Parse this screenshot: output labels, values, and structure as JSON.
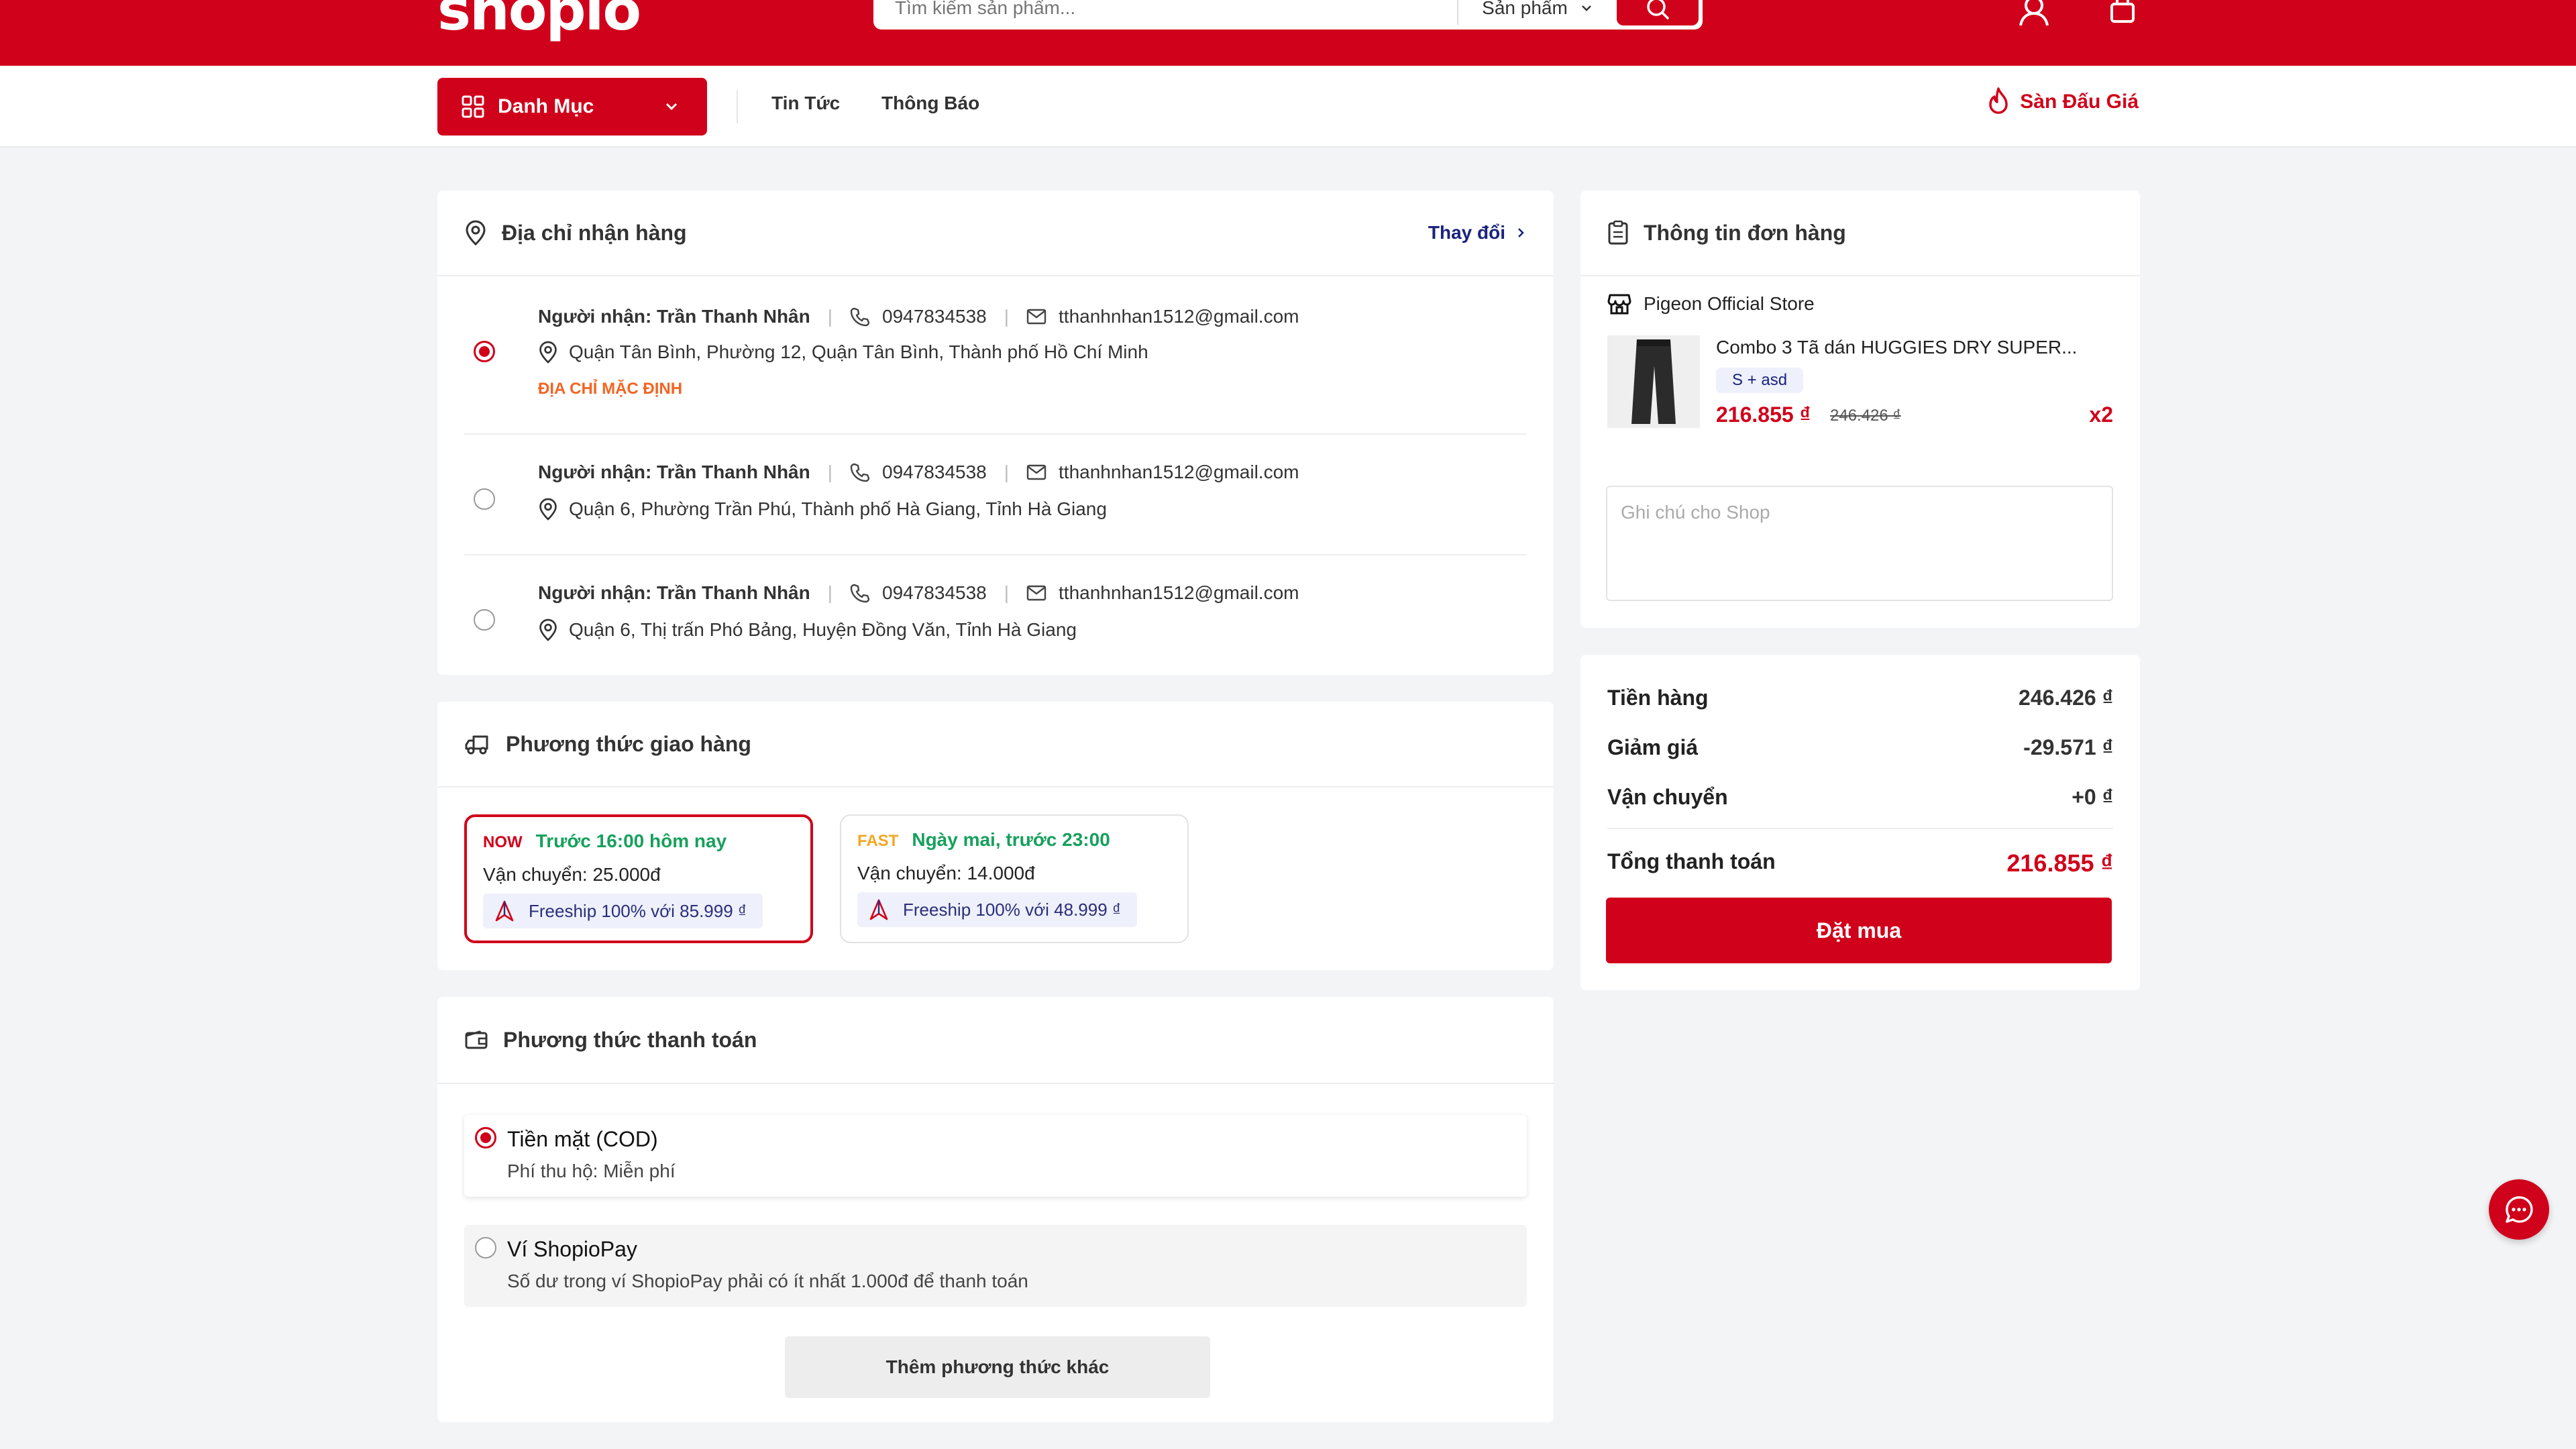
{
  "header": {
    "logo": "shopio",
    "search_placeholder": "Tìm kiếm sản phẩm...",
    "search_category": "Sản phẩm"
  },
  "nav": {
    "category_label": "Danh Mục",
    "links": [
      "Tin Tức",
      "Thông Báo"
    ],
    "auction_label": "Sàn Đấu Giá"
  },
  "address": {
    "title": "Địa chỉ nhận hàng",
    "change_label": "Thay đổi",
    "items": [
      {
        "recipient": "Người nhận: Trần Thanh Nhân",
        "phone": "0947834538",
        "email": "tthanhnhan1512@gmail.com",
        "address": "Quận Tân Bình, Phường 12, Quận Tân Bình, Thành phố Hồ Chí Minh",
        "badge": "ĐỊA CHỈ MẶC ĐỊNH",
        "selected": true
      },
      {
        "recipient": "Người nhận: Trần Thanh Nhân",
        "phone": "0947834538",
        "email": "tthanhnhan1512@gmail.com",
        "address": "Quận 6, Phường Trần Phú, Thành phố Hà Giang, Tỉnh Hà Giang",
        "selected": false
      },
      {
        "recipient": "Người nhận: Trần Thanh Nhân",
        "phone": "0947834538",
        "email": "tthanhnhan1512@gmail.com",
        "address": "Quận 6, Thị trấn Phó Bảng, Huyện Đồng Văn, Tỉnh Hà Giang",
        "selected": false
      }
    ]
  },
  "shipping": {
    "title": "Phương thức giao hàng",
    "options": [
      {
        "tag": "NOW",
        "tag_color": "#d0021b",
        "time": "Trước 16:00 hôm nay",
        "fee": "Vận chuyển: 25.000đ",
        "freeship": "Freeship 100% với 85.999 ₫",
        "selected": true
      },
      {
        "tag": "FAST",
        "tag_color": "#f5a623",
        "time": "Ngày mai, trước 23:00",
        "fee": "Vận chuyển: 14.000đ",
        "freeship": "Freeship 100% với 48.999 ₫",
        "selected": false
      }
    ]
  },
  "payment": {
    "title": "Phương thức thanh toán",
    "options": [
      {
        "title": "Tiền mặt (COD)",
        "desc": "Phí thu hộ: Miễn phí",
        "selected": true
      },
      {
        "title": "Ví ShopioPay",
        "desc": "Số dư trong ví ShopioPay phải có ít nhất 1.000đ để thanh toán",
        "selected": false
      }
    ],
    "more_label": "Thêm phương thức khác"
  },
  "order": {
    "title": "Thông tin đơn hàng",
    "store": "Pigeon Official Store",
    "product": {
      "name": "Combo 3 Tã dán HUGGIES DRY SUPER...",
      "variant": "S + asd",
      "price": "216.855 ₫",
      "original_price": "246.426 ₫",
      "qty": "x2"
    },
    "note_placeholder": "Ghi chú cho Shop"
  },
  "summary": {
    "subtotal_label": "Tiền hàng",
    "subtotal": "246.426 ₫",
    "discount_label": "Giảm giá",
    "discount": "-29.571 ₫",
    "shipping_label": "Vận chuyển",
    "shipping": "+0 ₫",
    "total_label": "Tổng thanh toán",
    "total": "216.855 ₫",
    "order_button": "Đặt mua"
  },
  "colors": {
    "brand": "#d0021b",
    "success": "#17a05d",
    "default_badge": "#f26522",
    "link": "#1a237e"
  }
}
